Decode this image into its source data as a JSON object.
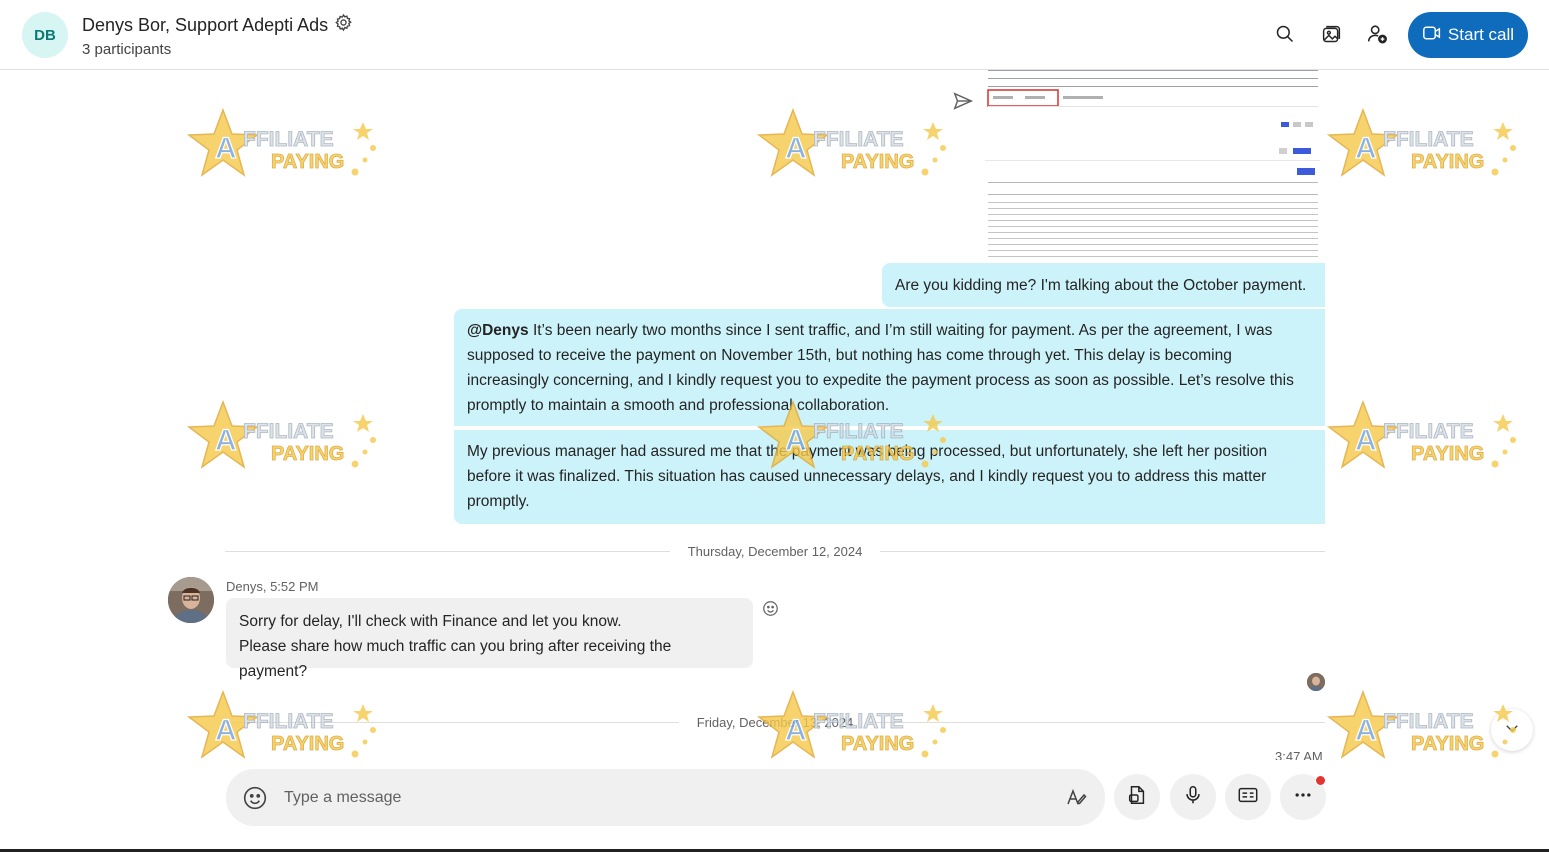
{
  "header": {
    "avatar_initials": "DB",
    "title": "Denys Bor, Support Adepti Ads",
    "subtitle": "3 participants",
    "start_call_label": "Start call",
    "icons": [
      "settings-gear-icon",
      "search-icon",
      "gallery-icon",
      "add-participant-icon",
      "video-call-icon"
    ]
  },
  "messages": {
    "outgoing_1": "Are you kidding me? I'm talking about the October payment.",
    "outgoing_2_mention": "@Denys",
    "outgoing_2_text": " It’s been nearly two months since I sent traffic, and I’m still waiting for payment. As per the agreement, I was supposed to receive the payment on November 15th, but nothing has come through yet. This delay is becoming increasingly concerning, and I kindly request you to expedite the payment process as soon as possible. Let’s resolve this promptly to maintain a smooth and professional collaboration.",
    "outgoing_3": "My previous manager had assured me that the payment was being processed, but unfortunately, she left her position before it was finalized. This situation has caused unnecessary delays, and I kindly request you to address this matter promptly.",
    "date_divider_1": "Thursday, December 12, 2024",
    "incoming_sender_meta": "Denys, 5:52 PM",
    "incoming_line_1": "Sorry for delay, I'll check with Finance and let you know.",
    "incoming_line_2": "Please share how much traffic can you bring after receiving the payment?",
    "date_divider_2": "Friday, December 13, 2024",
    "partial_time": "3:47 AM"
  },
  "watermark": {
    "line_1": "AFFILIATE",
    "line_2": "PAYING"
  },
  "composer": {
    "placeholder": "Type a message"
  },
  "colors": {
    "accent": "#0f6cbd",
    "outgoing_bubble": "#cdf3fa",
    "incoming_bubble": "#f0f0f0",
    "notification": "#e3342f"
  }
}
